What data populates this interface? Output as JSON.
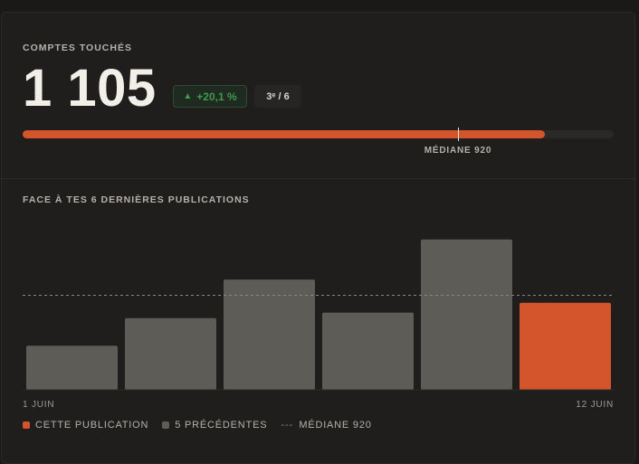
{
  "metric": {
    "label": "COMPTES TOUCHÉS",
    "value": "1 105",
    "value_num": 1105,
    "delta": "+20,1 %",
    "rank": "3ᵉ / 6",
    "max_scale": 1250
  },
  "median": {
    "value": 920,
    "label": "MÉDIANE 920"
  },
  "history": {
    "label": "FACE À TES 6 DERNIÈRES PUBLICATIONS",
    "start_label": "1 JUIN",
    "end_label": "12 JUIN"
  },
  "legend": {
    "current": "CETTE PUBLICATION",
    "previous": "5 PRÉCÉDENTES",
    "median_dash": "---",
    "median": "MÉDIANE 920"
  },
  "colors": {
    "accent": "#d4552b",
    "previous": "#5e5c57",
    "positive": "#3f9a4c"
  },
  "chart_data": {
    "type": "bar",
    "values": [
      560,
      910,
      1400,
      980,
      1910,
      1105
    ],
    "highlight_index": 5,
    "reference_line": 1200,
    "ylim": [
      0,
      4950
    ]
  }
}
